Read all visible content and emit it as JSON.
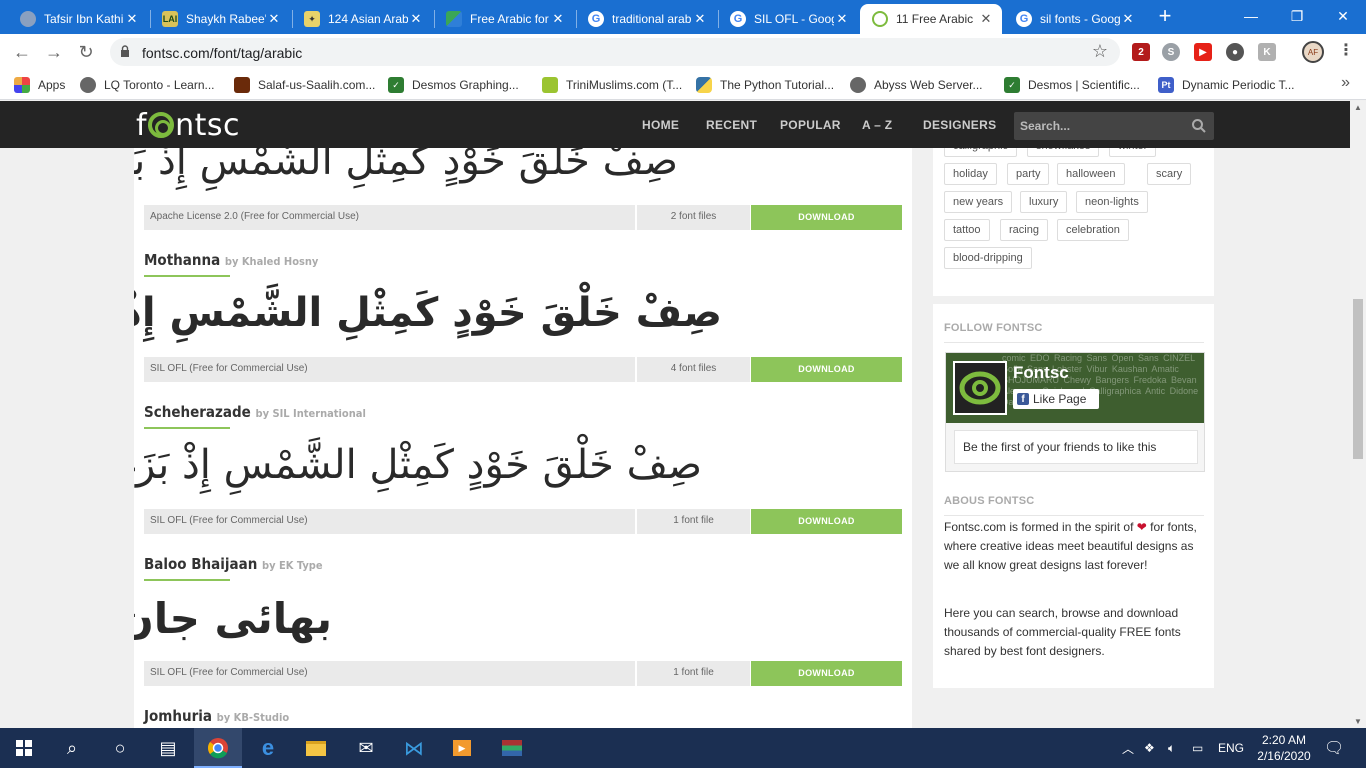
{
  "browser": {
    "tabs": [
      {
        "title": "Tafsir Ibn Kathi",
        "icon": "globe-icon",
        "active": false
      },
      {
        "title": "Shaykh Rabee'",
        "icon": "lai-icon",
        "active": false
      },
      {
        "title": "124 Asian Arab",
        "icon": "site-icon",
        "active": false
      },
      {
        "title": "Free Arabic for",
        "icon": "map-icon",
        "active": false
      },
      {
        "title": "traditional arab",
        "icon": "google-icon",
        "active": false
      },
      {
        "title": "SIL OFL - Goog",
        "icon": "google-icon",
        "active": false
      },
      {
        "title": "11 Free Arabic",
        "icon": "fontsc-icon",
        "active": true
      },
      {
        "title": "sil fonts - Goog",
        "icon": "google-icon",
        "active": false
      }
    ],
    "url": "fontsc.com/font/tag/arabic",
    "bookmarks": [
      {
        "label": "Apps"
      },
      {
        "label": "LQ Toronto - Learn..."
      },
      {
        "label": "Salaf-us-Saalih.com..."
      },
      {
        "label": "Desmos Graphing..."
      },
      {
        "label": "TriniMuslims.com (T..."
      },
      {
        "label": "The Python Tutorial..."
      },
      {
        "label": "Abyss Web Server..."
      },
      {
        "label": "Desmos | Scientific..."
      },
      {
        "label": "Dynamic Periodic T..."
      }
    ],
    "extension_badge": "2",
    "profile_initials": "AF"
  },
  "site": {
    "logo": "fontsc",
    "nav": [
      "HOME",
      "RECENT",
      "POPULAR",
      "A – Z",
      "DESIGNERS"
    ],
    "search_placeholder": "Search..."
  },
  "fonts": [
    {
      "name": "",
      "by": "",
      "sample": "صِفْ خَلْقَ خَوْدٍ كَمِثْلِ الشَّمْسِ إِذْ بَزَغَتْ",
      "license": "Apache License 2.0 (Free for Commercial Use)",
      "files": "2 font files",
      "download": "DOWNLOAD"
    },
    {
      "name": "Mothanna",
      "by": "by Khaled Hosny",
      "sample": "صِفْ خَلْقَ خَوْدٍ كَمِثْلِ الشَّمْسِ إِذْ بَزَغَتْ",
      "license": "SIL OFL (Free for Commercial Use)",
      "files": "4 font files",
      "download": "DOWNLOAD"
    },
    {
      "name": "Scheherazade",
      "by": "by SIL International",
      "sample": "صِفْ خَلْقَ خَوْدٍ كَمِثْلِ الشَّمْسِ إِذْ بَزَغَتْ",
      "license": "SIL OFL (Free for Commercial Use)",
      "files": "1 font file",
      "download": "DOWNLOAD"
    },
    {
      "name": "Baloo Bhaijaan",
      "by": "by EK Type",
      "sample": "بهائی جان",
      "license": "SIL OFL (Free for Commercial Use)",
      "files": "1 font file",
      "download": "DOWNLOAD"
    },
    {
      "name": "Jomhuria",
      "by": "by KB-Studio",
      "sample": "",
      "license": "",
      "files": "",
      "download": ""
    }
  ],
  "sidebar": {
    "tags": [
      "calligraphic",
      "snowflakes",
      "winter",
      "holiday",
      "party",
      "halloween",
      "scary",
      "new years",
      "luxury",
      "neon-lights",
      "tattoo",
      "racing",
      "celebration",
      "blood-dripping"
    ],
    "follow_heading": "FOLLOW FONTSC",
    "fb_page_name": "Fontsc",
    "fb_like": "Like Page",
    "fb_first": "Be the first of your friends to like this",
    "fb_cover_words": "comic EDO Racing Sans Open Sans CINZEL Sofia Sans Lobster Vibur Kaushan Amatic SHOJUMARU Chewy Bangers Fredoka Bevan Alegreya Quicksand Calligraphica Antic Didone Damion Comfortaa",
    "about_heading": "ABOUS FONTSC",
    "about_p1_before": "Fontsc.com is formed in the spirit of",
    "about_p1_after": "for fonts, where creative ideas meet beautiful designs as we all know great designs last forever!",
    "about_p2": "Here you can search, browse and download thousands of commercial-quality FREE fonts shared by best font designers."
  },
  "taskbar": {
    "language": "ENG",
    "time": "2:20 AM",
    "date": "2/16/2020"
  },
  "colors": {
    "chrome_tabbar": "#1a6fd1",
    "site_header": "#242424",
    "accent_green": "#8dc55a",
    "taskbar": "#1b2f52"
  }
}
